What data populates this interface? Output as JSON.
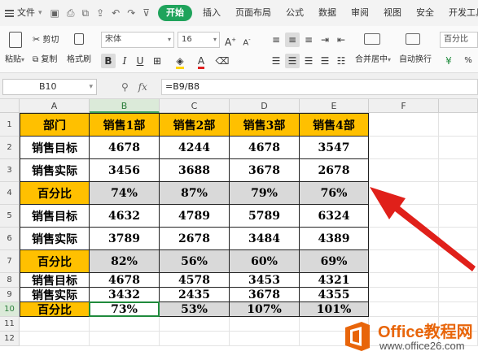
{
  "menu": {
    "file": "文件",
    "tabs": [
      "开始",
      "插入",
      "页面布局",
      "公式",
      "数据",
      "审阅",
      "视图",
      "安全",
      "开发工具"
    ]
  },
  "ribbon": {
    "paste": "粘贴",
    "cut": "剪切",
    "copy": "复制",
    "format_painter": "格式刷",
    "font_name": "宋体",
    "font_size": "16",
    "merge_center": "合并居中",
    "wrap_text": "自动换行",
    "number_format": "百分比"
  },
  "formula_bar": {
    "name_box": "B10",
    "fx": "fx",
    "formula": "=B9/B8"
  },
  "columns": [
    "A",
    "B",
    "C",
    "D",
    "E",
    "F"
  ],
  "rows": [
    "1",
    "2",
    "3",
    "4",
    "5",
    "6",
    "7",
    "8",
    "9",
    "10",
    "11",
    "12"
  ],
  "table": [
    [
      "部门",
      "销售1部",
      "销售2部",
      "销售3部",
      "销售4部"
    ],
    [
      "销售目标",
      "4678",
      "4244",
      "4678",
      "3547"
    ],
    [
      "销售实际",
      "3456",
      "3688",
      "3678",
      "2678"
    ],
    [
      "百分比",
      "74%",
      "87%",
      "79%",
      "76%"
    ],
    [
      "销售目标",
      "4632",
      "4789",
      "5789",
      "6324"
    ],
    [
      "销售实际",
      "3789",
      "2678",
      "3484",
      "4389"
    ],
    [
      "百分比",
      "82%",
      "56%",
      "60%",
      "69%"
    ],
    [
      "销售目标",
      "4678",
      "4578",
      "3453",
      "4321"
    ],
    [
      "销售实际",
      "3432",
      "2435",
      "3678",
      "4355"
    ],
    [
      "百分比",
      "73%",
      "53%",
      "107%",
      "101%"
    ]
  ],
  "watermark": {
    "brand": "Office教程网",
    "url": "www.office26.com"
  },
  "colors": {
    "header_fill": "#ffc000",
    "percent_fill": "#d9d9d9",
    "active_tab": "#1fa35b",
    "arrow": "#e0201a",
    "brand": "#e8650a"
  }
}
